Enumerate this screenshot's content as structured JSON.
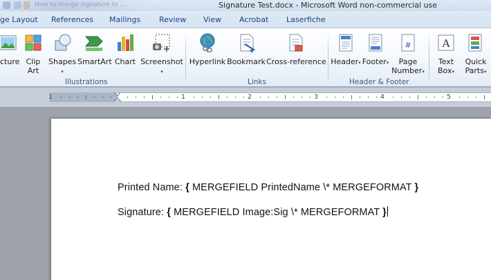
{
  "window": {
    "faded_tab_title": "How to merge signature to ...",
    "title": "Signature Test.docx - Microsoft Word non-commercial use"
  },
  "tabs": [
    {
      "label": "ge Layout"
    },
    {
      "label": "References"
    },
    {
      "label": "Mailings"
    },
    {
      "label": "Review"
    },
    {
      "label": "View"
    },
    {
      "label": "Acrobat"
    },
    {
      "label": "Laserfiche"
    }
  ],
  "ribbon": {
    "groups": {
      "illustrations": "Illustrations",
      "links": "Links",
      "header_footer": "Header & Footer"
    },
    "buttons": {
      "picture": "cture",
      "clip_art_1": "Clip",
      "clip_art_2": "Art",
      "shapes": "Shapes",
      "smartart": "SmartArt",
      "chart": "Chart",
      "screenshot": "Screenshot",
      "hyperlink": "Hyperlink",
      "bookmark": "Bookmark",
      "cross_reference": "Cross-reference",
      "header": "Header",
      "footer": "Footer",
      "page_number_1": "Page",
      "page_number_2": "Number",
      "text_box_1": "Text",
      "text_box_2": "Box",
      "quick_parts_1": "Quick",
      "quick_parts_2": "Parts"
    },
    "caret": "▾"
  },
  "ruler": {
    "numbers": [
      "1",
      "1",
      "2",
      "3",
      "4",
      "5"
    ]
  },
  "document": {
    "line1": {
      "label": "Printed Name: ",
      "open": "{",
      "code": " MERGEFIELD  PrintedName  \\* MERGEFORMAT ",
      "close": "}"
    },
    "line2": {
      "label": "Signature: ",
      "open": "{",
      "code": " MERGEFIELD  Image:Sig  \\* MERGEFORMAT ",
      "close": "}"
    }
  },
  "colors": {
    "ribbon_text": "#1e395b",
    "tab_text": "#15428b",
    "canvas": "#9ea3ab"
  }
}
